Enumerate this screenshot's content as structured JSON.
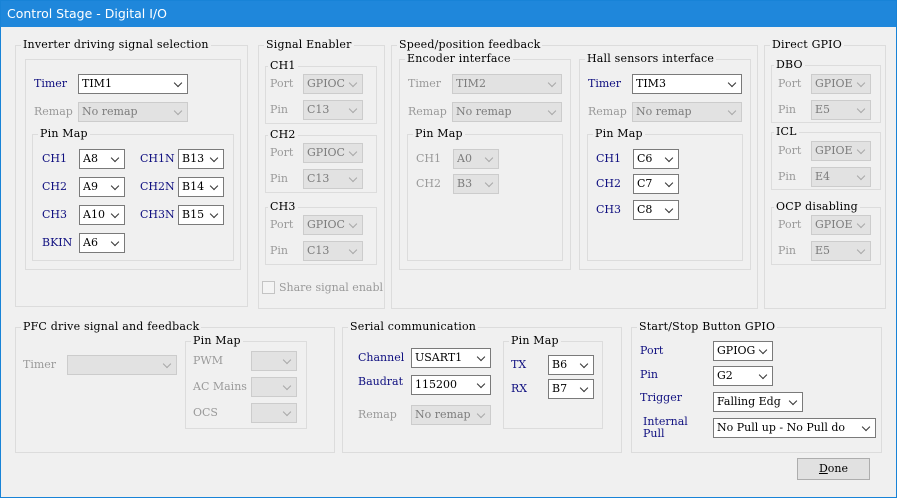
{
  "window": {
    "title": "Control Stage - Digital I/O"
  },
  "inverter": {
    "title": "Inverter driving signal selection",
    "timer_label": "Timer",
    "timer_value": "TIM1",
    "remap_label": "Remap",
    "remap_value": "No remap",
    "pinmap_title": "Pin Map",
    "ch1_label": "CH1",
    "ch1_value": "A8",
    "ch1n_label": "CH1N",
    "ch1n_value": "B13",
    "ch2_label": "CH2",
    "ch2_value": "A9",
    "ch2n_label": "CH2N",
    "ch2n_value": "B14",
    "ch3_label": "CH3",
    "ch3_value": "A10",
    "ch3n_label": "CH3N",
    "ch3n_value": "B15",
    "bkin_label": "BKIN",
    "bkin_value": "A6"
  },
  "signal_enabler": {
    "title": "Signal Enabler",
    "ch1_title": "CH1",
    "ch2_title": "CH2",
    "ch3_title": "CH3",
    "port_label": "Port",
    "pin_label": "Pin",
    "ch1_port": "GPIOC",
    "ch1_pin": "C13",
    "ch2_port": "GPIOC",
    "ch2_pin": "C13",
    "ch3_port": "GPIOC",
    "ch3_pin": "C13",
    "share_label": "Share signal enabl"
  },
  "speed": {
    "title": "Speed/position feedback",
    "encoder": {
      "title": "Encoder interface",
      "timer_label": "Timer",
      "timer_value": "TIM2",
      "remap_label": "Remap",
      "remap_value": "No remap",
      "pinmap_title": "Pin Map",
      "ch1_label": "CH1",
      "ch1_value": "A0",
      "ch2_label": "CH2",
      "ch2_value": "B3"
    },
    "hall": {
      "title": "Hall sensors interface",
      "timer_label": "Timer",
      "timer_value": "TIM3",
      "remap_label": "Remap",
      "remap_value": "No remap",
      "pinmap_title": "Pin Map",
      "ch1_label": "CH1",
      "ch1_value": "C6",
      "ch2_label": "CH2",
      "ch2_value": "C7",
      "ch3_label": "CH3",
      "ch3_value": "C8"
    }
  },
  "direct_gpio": {
    "title": "Direct GPIO",
    "dbo_title": "DBO",
    "icl_title": "ICL",
    "ocp_title": "OCP disabling",
    "port_label": "Port",
    "pin_label": "Pin",
    "dbo_port": "GPIOE",
    "dbo_pin": "E5",
    "icl_port": "GPIOE",
    "icl_pin": "E4",
    "ocp_port": "GPIOE",
    "ocp_pin": "E5"
  },
  "pfc": {
    "title": "PFC drive signal and feedback",
    "timer_label": "Timer",
    "timer_value": "",
    "pinmap_title": "Pin Map",
    "pwm_label": "PWM",
    "pwm_value": "",
    "acmains_label": "AC Mains",
    "acmains_value": "",
    "ocs_label": "OCS",
    "ocs_value": ""
  },
  "serial": {
    "title": "Serial communication",
    "channel_label": "Channel",
    "channel_value": "USART1",
    "baudrate_label": "Baudrat",
    "baudrate_value": "115200",
    "remap_label": "Remap",
    "remap_value": "No remap",
    "pinmap_title": "Pin Map",
    "tx_label": "TX",
    "tx_value": "B6",
    "rx_label": "RX",
    "rx_value": "B7"
  },
  "startstop": {
    "title": "Start/Stop Button GPIO",
    "port_label": "Port",
    "port_value": "GPIOG",
    "pin_label": "Pin",
    "pin_value": "G2",
    "trigger_label": "Trigger",
    "trigger_value": "Falling Edg",
    "pull_label_1": "Internal",
    "pull_label_2": "Pull",
    "pull_value": "No Pull up - No Pull do"
  },
  "done_label": "Done"
}
